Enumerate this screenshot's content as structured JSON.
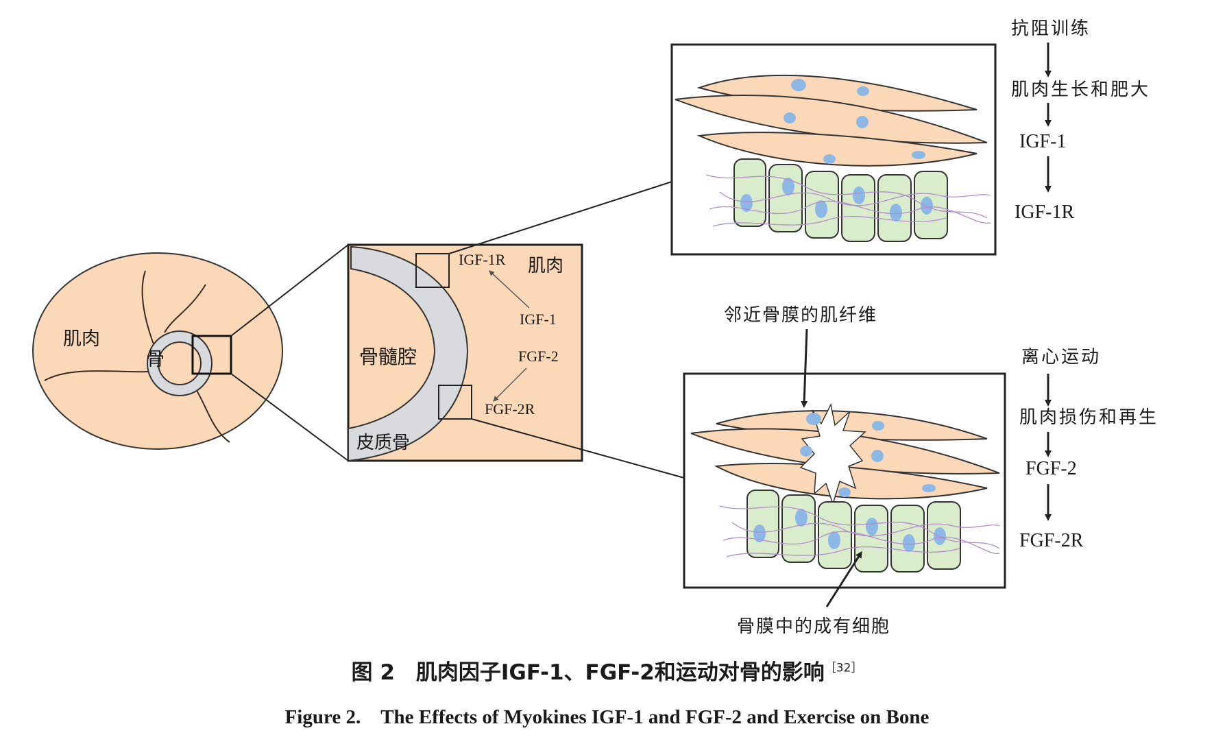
{
  "left_panel": {
    "muscle_label": "肌肉",
    "bone_label": "骨"
  },
  "middle_panel": {
    "marrow_label": "骨髓腔",
    "cortical_label": "皮质骨",
    "muscle_label": "肌肉",
    "igf1r_label": "IGF-1R",
    "igf1_label": "IGF-1",
    "fgf2_label": "FGF-2",
    "fgf2r_label": "FGF-2R"
  },
  "top_pathway": [
    "抗阻训练",
    "肌肉生长和肥大",
    "IGF-1",
    "IGF-1R"
  ],
  "bottom_pathway": [
    "离心运动",
    "肌肉损伤和再生",
    "FGF-2",
    "FGF-2R"
  ],
  "annotations": {
    "fiber_near_periosteum": "邻近骨膜的肌纤维",
    "osteoblasts_in_periosteum": "骨膜中的成有细胞"
  },
  "caption": {
    "zh": "图 2　肌肉因子IGF-1、FGF-2和运动对骨的影响",
    "ref": "［32］",
    "en": "Figure 2.　The Effects of Myokines IGF-1 and FGF-2 and Exercise on Bone"
  },
  "colors": {
    "muscle_fill": "#fbd8b8",
    "bone_fill": "#d9dadd",
    "nucleus_fill": "#8db8e6",
    "osteoblast_fill": "#d9eccb",
    "fiber_line": "#b48ccb",
    "outline": "#222222"
  }
}
